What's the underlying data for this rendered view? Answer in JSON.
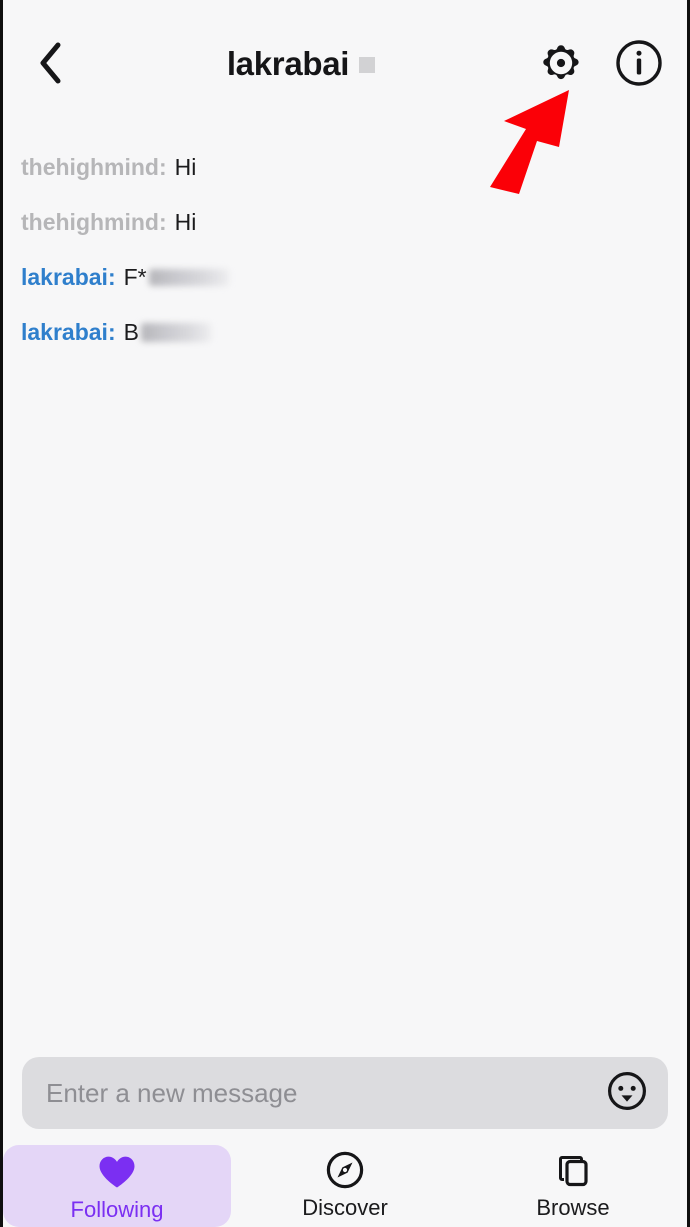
{
  "header": {
    "back_icon": "chevron-left-icon",
    "title": "lakrabai",
    "title_glyph": "missing-glyph-placeholder",
    "settings_icon": "gear-icon",
    "info_icon": "info-circle-icon"
  },
  "annotation": {
    "shape": "arrow-up-right",
    "color": "#fb0007",
    "points_to": "gear-icon"
  },
  "messages": [
    {
      "user": "thehighmind:",
      "self": false,
      "text": "Hi",
      "redacted": null
    },
    {
      "user": "thehighmind:",
      "self": false,
      "text": "Hi",
      "redacted": null
    },
    {
      "user": "lakrabai:",
      "self": true,
      "text": "F*",
      "redacted": "blurred"
    },
    {
      "user": "lakrabai:",
      "self": true,
      "text": "B",
      "redacted": "blurred"
    }
  ],
  "composer": {
    "placeholder": "Enter a new message",
    "value": "",
    "emoji_icon": "smiley-face-icon"
  },
  "tabbar": {
    "items": [
      {
        "label": "Following",
        "icon": "heart-icon",
        "active": true
      },
      {
        "label": "Discover",
        "icon": "compass-icon",
        "active": false
      },
      {
        "label": "Browse",
        "icon": "copy-icon",
        "active": false
      }
    ]
  },
  "colors": {
    "page_background": "#f7f7f8",
    "self_username": "#2f7fcc",
    "other_username": "#b6b6b8",
    "message_text": "#1b1b1d",
    "accent_purple": "#7b2ff2",
    "active_tab_background": "#e4d6f7",
    "annotation_red": "#fb0007",
    "composer_background": "#dcdcdf"
  }
}
